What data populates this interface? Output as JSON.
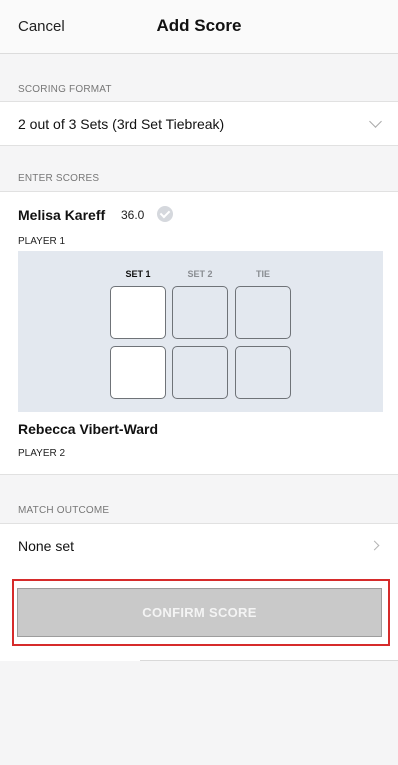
{
  "header": {
    "cancel_label": "Cancel",
    "title": "Add Score"
  },
  "scoring_format": {
    "section_label": "SCORING FORMAT",
    "value": "2 out of 3 Sets (3rd Set Tiebreak)"
  },
  "enter_scores": {
    "section_label": "ENTER SCORES",
    "player1": {
      "name": "Melisa Kareff",
      "rating": "36.0",
      "label": "PLAYER 1"
    },
    "player2": {
      "name": "Rebecca Vibert-Ward",
      "label": "PLAYER 2"
    },
    "columns": [
      "SET 1",
      "SET 2",
      "TIE"
    ]
  },
  "match_outcome": {
    "section_label": "MATCH OUTCOME",
    "value": "None set"
  },
  "confirm": {
    "label": "CONFIRM SCORE"
  },
  "colors": {
    "accent_highlight": "#d62b2b",
    "score_panel_bg": "#e3e8ef",
    "disabled_button": "#c9c9c9"
  }
}
